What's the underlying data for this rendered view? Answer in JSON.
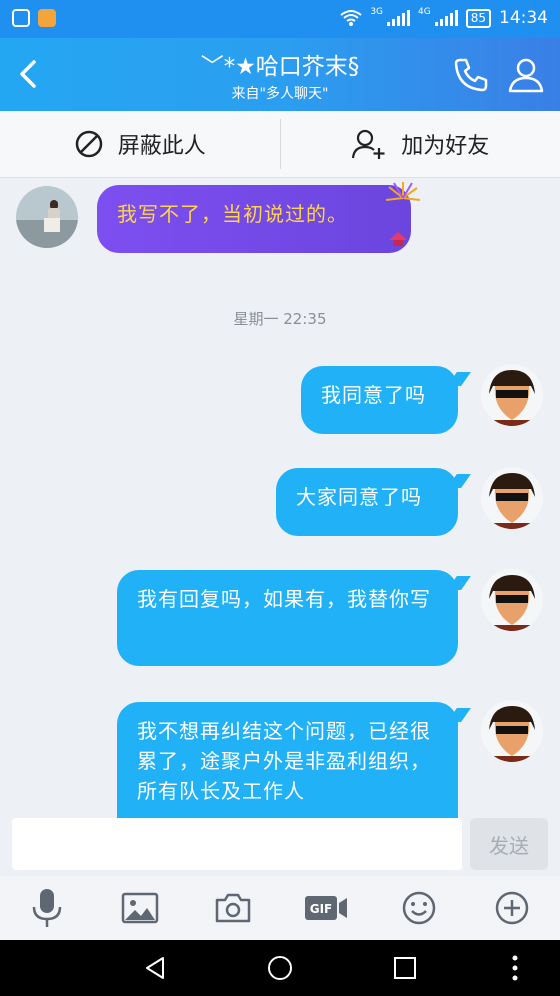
{
  "status_bar": {
    "net_1": "3G",
    "net_2": "4G",
    "battery": "85",
    "time": "14:34"
  },
  "header": {
    "title": "﹀*★哈口芥末§",
    "subtitle": "来自\"多人聊天\""
  },
  "actions": {
    "block_label": "屏蔽此人",
    "add_friend_label": "加为好友"
  },
  "messages": [
    {
      "side": "in",
      "text": "我写不了，当初说过的。"
    },
    {
      "side": "out",
      "text": "我同意了吗"
    },
    {
      "side": "out",
      "text": "大家同意了吗"
    },
    {
      "side": "out",
      "text": "我有回复吗，如果有，我替你写"
    },
    {
      "side": "out",
      "text": "我不想再纠结这个问题，已经很累了，途聚户外是非盈利组织，所有队长及工作人"
    }
  ],
  "timestamp": "星期一 22:35",
  "input": {
    "send_label": "发送"
  },
  "toolbar": [
    "microphone-icon",
    "image-icon",
    "camera-icon",
    "gif-icon",
    "emoji-icon",
    "plus-icon"
  ]
}
